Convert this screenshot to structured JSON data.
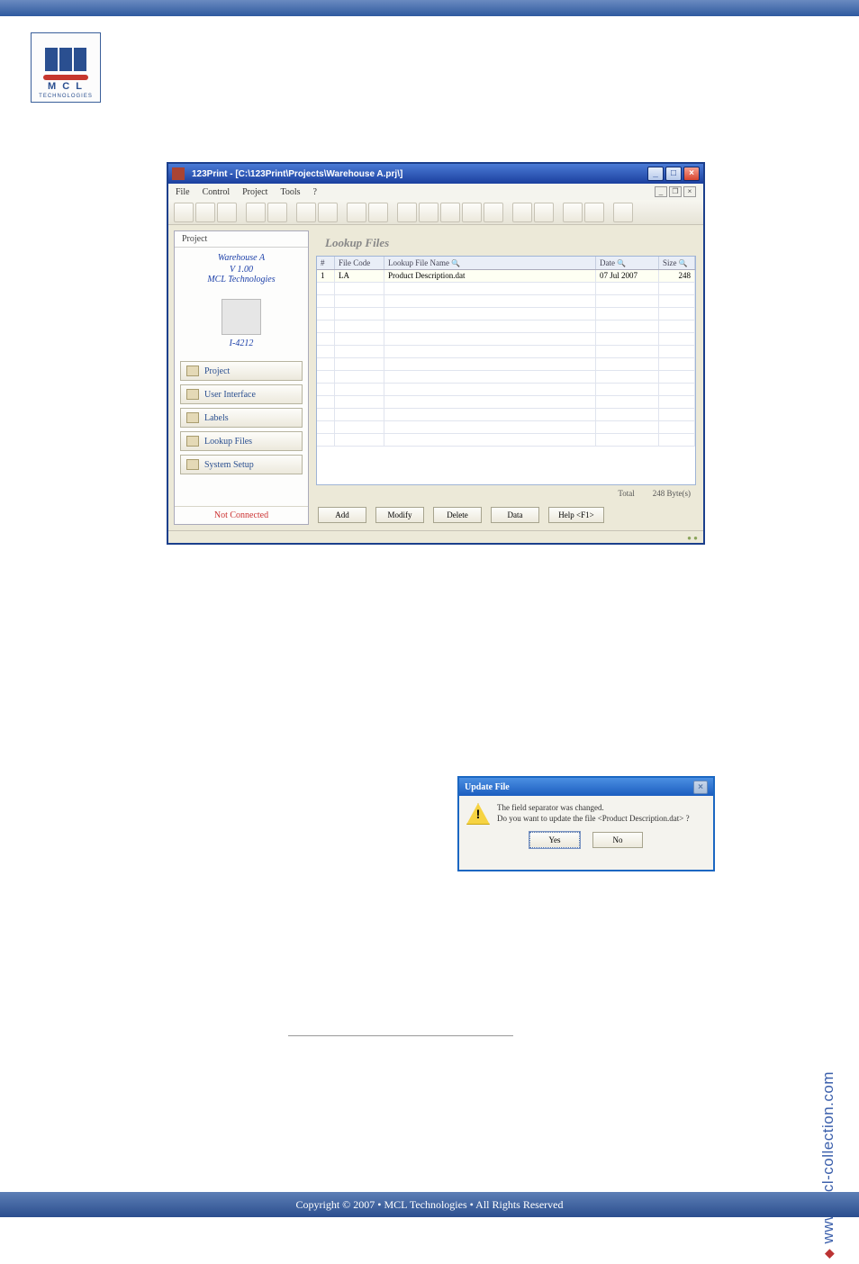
{
  "app": {
    "title": "123Print - [C:\\123Print\\Projects\\Warehouse A.prj\\]"
  },
  "menu": {
    "file": "File",
    "control": "Control",
    "project": "Project",
    "tools": "Tools",
    "help": "?"
  },
  "sidebar": {
    "tab": "Project",
    "projectName": "Warehouse A",
    "version": "V 1.00",
    "company": "MCL Technologies",
    "printer": "I-4212",
    "items": [
      "Project",
      "User Interface",
      "Labels",
      "Lookup Files",
      "System Setup"
    ],
    "status": "Not Connected"
  },
  "lookup": {
    "title": "Lookup Files",
    "headers": {
      "num": "#",
      "code": "File Code",
      "name": "Lookup File Name",
      "date": "Date",
      "size": "Size"
    },
    "rows": [
      {
        "num": "1",
        "code": "LA",
        "name": "Product Description.dat",
        "date": "07 Jul 2007",
        "size": "248"
      }
    ],
    "totals": {
      "total_label": "Total",
      "total_value": "248 Byte(s)"
    },
    "buttons": {
      "add": "Add",
      "modify": "Modify",
      "delete": "Delete",
      "data": "Data",
      "help": "Help <F1>"
    }
  },
  "dialog": {
    "title": "Update File",
    "line1": "The field separator was changed.",
    "line2": "Do you want to update the file <Product Description.dat> ?",
    "yes": "Yes",
    "no": "No"
  },
  "sideurl": "www.mcl-collection.com",
  "footer": "Copyright © 2007 • MCL Technologies • All Rights Reserved"
}
